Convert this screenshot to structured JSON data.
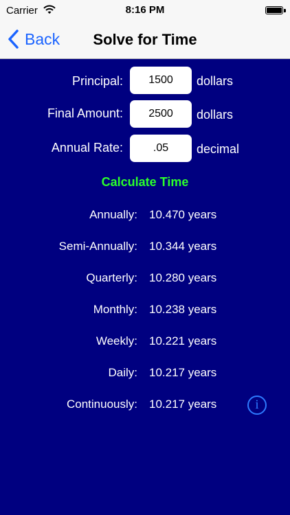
{
  "status": {
    "carrier": "Carrier",
    "time": "8:16 PM"
  },
  "nav": {
    "back_label": "Back",
    "title": "Solve for Time"
  },
  "inputs": [
    {
      "label": "Principal:",
      "value": "1500",
      "unit": "dollars"
    },
    {
      "label": "Final Amount:",
      "value": "2500",
      "unit": "dollars"
    },
    {
      "label": "Annual Rate:",
      "value": ".05",
      "unit": "decimal"
    }
  ],
  "calculate_label": "Calculate Time",
  "results": [
    {
      "label": "Annually:",
      "value": "10.470 years"
    },
    {
      "label": "Semi-Annually:",
      "value": "10.344 years"
    },
    {
      "label": "Quarterly:",
      "value": "10.280 years"
    },
    {
      "label": "Monthly:",
      "value": "10.238 years"
    },
    {
      "label": "Weekly:",
      "value": "10.221 years"
    },
    {
      "label": "Daily:",
      "value": "10.217 years"
    },
    {
      "label": "Continuously:",
      "value": "10.217 years"
    }
  ],
  "info_icon": "info-icon",
  "colors": {
    "background": "#000080",
    "accent": "#1a63ff",
    "calculate": "#2bff2b"
  }
}
